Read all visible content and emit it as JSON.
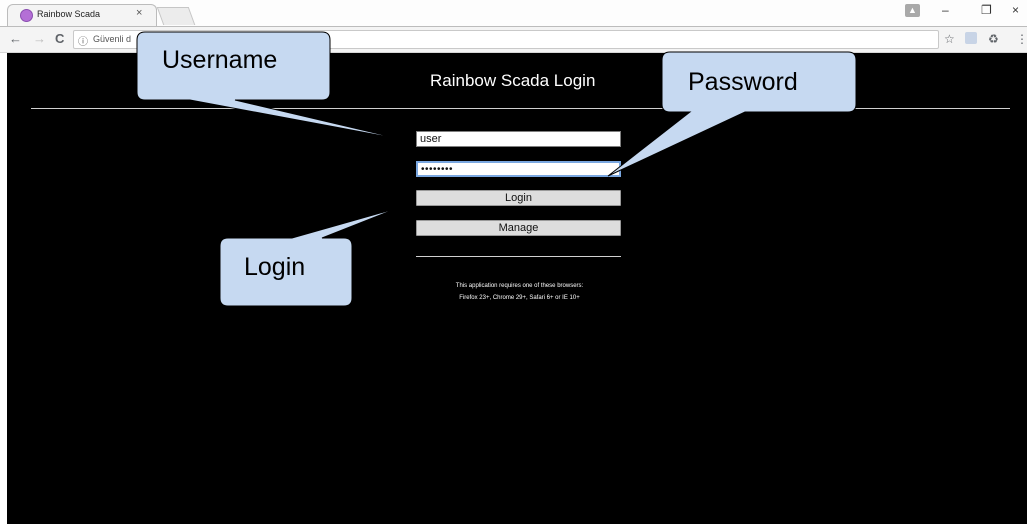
{
  "browser": {
    "tab_title": "Rainbow Scada",
    "tab_close_glyph": "×",
    "profile_glyph": "▲",
    "win_minimize": "–",
    "win_restore": "❐",
    "win_close": "×",
    "nav_back": "←",
    "nav_forward": "→",
    "nav_reload": "C",
    "omnibox_info": "ⓘ",
    "omnibox_label": "Güvenli d",
    "bookmark_glyph": "☆",
    "extension_glyph": "♻",
    "menu_glyph": "⋮"
  },
  "page": {
    "title": "Rainbow Scada Login",
    "username_value": "user",
    "password_value": "••••••••",
    "login_label": "Login",
    "manage_label": "Manage",
    "browser_note_line1": "This application requires one of these browsers:",
    "browser_note_line2": "Firefox 23+, Chrome 29+, Safari 6+ or IE 10+"
  },
  "callouts": {
    "username": "Username",
    "password": "Password",
    "login": "Login"
  },
  "colors": {
    "page_background": "#000000",
    "callout_fill": "#c6d9f1",
    "callout_stroke": "#000000",
    "favicon": "#b46fd6"
  }
}
